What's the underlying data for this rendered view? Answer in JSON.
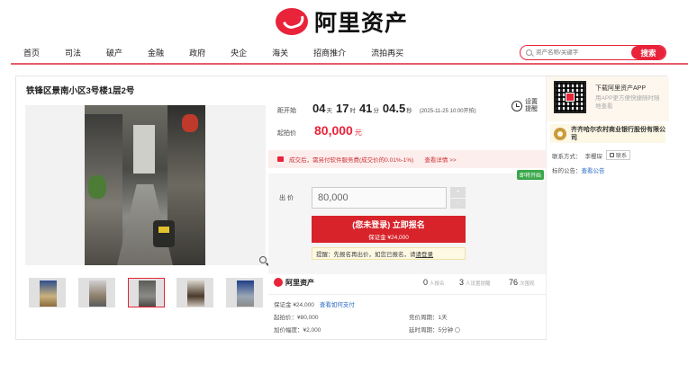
{
  "brand": {
    "name": "阿里资产"
  },
  "nav": {
    "items": [
      "首页",
      "司法",
      "破产",
      "金融",
      "政府",
      "央企",
      "海关",
      "招商推介",
      "流拍再买"
    ]
  },
  "search": {
    "placeholder": "资产名称/关键字",
    "button": "搜索"
  },
  "listing": {
    "title": "铁锋区景南小区3号楼1层2号",
    "countdown": {
      "label": "距开始",
      "days": "04",
      "days_unit": "天",
      "hours": "17",
      "hours_unit": "时",
      "minutes": "41",
      "minutes_unit": "分",
      "seconds": "04.5",
      "seconds_unit": "秒",
      "start_time": "(2025-11-25 10:00开拍)"
    },
    "remind": {
      "line1": "设置",
      "line2": "提醒"
    },
    "start_price": {
      "label": "起拍价",
      "value": "80,000",
      "unit": "元"
    },
    "service_notice": "成交后，需另付软件服务费(成交价的0.01%-1%)",
    "service_detail_link": "查看详情 >>",
    "status_badge": "即将开始",
    "bid": {
      "label": "出  价",
      "value": "80,000",
      "stepper_up": "+",
      "stepper_down": "-"
    },
    "register_button": {
      "line1": "(您未登录) 立即报名",
      "line2": "保证金 ¥24,000"
    },
    "tip": {
      "text": "提醒：先报名再出价，如您已报名，请",
      "link": "请登录"
    },
    "stats": {
      "signup_count": "0",
      "signup_label": "人报名",
      "remind_count": "3",
      "remind_label": "人设置提醒",
      "views_count": "76",
      "views_label": "次围观"
    },
    "meta": {
      "deposit_label": "保证金",
      "deposit_value": "¥24,000",
      "deposit_link": "查看如何支付",
      "start_price_label": "起拍价",
      "start_price_value": "¥80,000",
      "increment_label": "加价幅度",
      "increment_value": "¥2,000",
      "bid_cycle_label": "竞价周期",
      "bid_cycle_value": "1天",
      "delay_label": "延时周期",
      "delay_value": "5分钟"
    },
    "photos": {
      "thumb_count": 5,
      "active_thumb": 3
    }
  },
  "side": {
    "app_title": "下载阿里资产APP",
    "app_desc": "用APP更方便快捷随时随地查看",
    "bank_name": "齐齐哈尔农村商业银行股份有限公司",
    "contact_label": "联系方式：",
    "contact_name": "李樱琛",
    "contact_button": "联系",
    "notice_label": "标的公告：",
    "notice_link": "查看公告"
  },
  "colors": {
    "brand_red": "#e8233a",
    "button_red": "#d8232a",
    "badge_green": "#3aa84b",
    "link_blue": "#2e6bc6"
  }
}
